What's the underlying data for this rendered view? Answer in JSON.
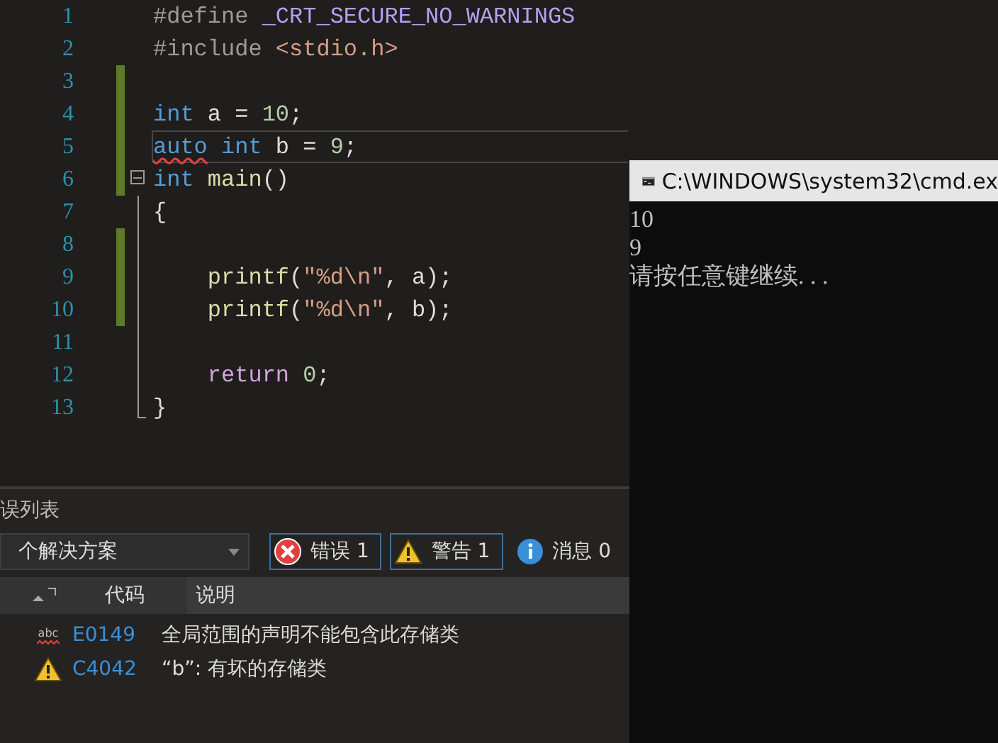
{
  "editor": {
    "lines": [
      {
        "number": "1",
        "changed": false,
        "current": false,
        "tokens": [
          {
            "t": "#define",
            "kind": "pre"
          },
          {
            "t": " _CRT_SECURE_NO_WARNINGS",
            "kind": "macro"
          }
        ]
      },
      {
        "number": "2",
        "changed": false,
        "current": false,
        "tokens": [
          {
            "t": "#include",
            "kind": "pre"
          },
          {
            "t": " <stdio.h>",
            "kind": "str"
          }
        ]
      },
      {
        "number": "3",
        "changed": true,
        "current": false
      },
      {
        "number": "4",
        "changed": true,
        "current": false,
        "tokens": [
          {
            "t": "int",
            "kind": "kw"
          },
          {
            "t": " a =",
            "kind": "id"
          },
          {
            "t": " 10",
            "kind": "num"
          },
          {
            "t": ";",
            "kind": "id"
          }
        ]
      },
      {
        "number": "5",
        "changed": true,
        "current": true,
        "tokens": [
          {
            "t": "auto",
            "kind": "kw",
            "error": true
          },
          {
            "t": " int",
            "kind": "kw"
          },
          {
            "t": " b =",
            "kind": "id"
          },
          {
            "t": " 9",
            "kind": "num"
          },
          {
            "t": ";",
            "kind": "id"
          }
        ]
      },
      {
        "number": "6",
        "changed": true,
        "current": false,
        "collapsible": true,
        "tokens": [
          {
            "t": "int",
            "kind": "kw"
          },
          {
            "t": " main",
            "kind": "fn"
          },
          {
            "t": "()",
            "kind": "id"
          }
        ]
      },
      {
        "number": "7",
        "changed": false,
        "current": false,
        "in_block": true,
        "tokens": [
          {
            "t": "{",
            "kind": "id"
          }
        ]
      },
      {
        "number": "8",
        "changed": true,
        "current": false,
        "in_block": true
      },
      {
        "number": "9",
        "changed": true,
        "current": false,
        "in_block": true,
        "tokens": [
          {
            "t": "    printf",
            "kind": "fn"
          },
          {
            "t": "(",
            "kind": "id"
          },
          {
            "t": "\"%d\\n\"",
            "kind": "str"
          },
          {
            "t": ", a);",
            "kind": "id"
          }
        ]
      },
      {
        "number": "10",
        "changed": true,
        "current": false,
        "in_block": true,
        "tokens": [
          {
            "t": "    printf",
            "kind": "fn"
          },
          {
            "t": "(",
            "kind": "id"
          },
          {
            "t": "\"%d\\n\"",
            "kind": "str"
          },
          {
            "t": ", b);",
            "kind": "id"
          }
        ]
      },
      {
        "number": "11",
        "changed": false,
        "current": false,
        "in_block": true
      },
      {
        "number": "12",
        "changed": false,
        "current": false,
        "in_block": true,
        "tokens": [
          {
            "t": "    return",
            "kind": "ctl"
          },
          {
            "t": " 0",
            "kind": "num"
          },
          {
            "t": ";",
            "kind": "id"
          }
        ]
      },
      {
        "number": "13",
        "changed": false,
        "current": false,
        "in_block": true,
        "block_end": true,
        "tokens": [
          {
            "t": "}",
            "kind": "id"
          }
        ]
      }
    ]
  },
  "error_list": {
    "title": "误列表",
    "scope": "个解决方案",
    "filters": [
      {
        "kind": "error",
        "label": "错误 1",
        "selected": true
      },
      {
        "kind": "warning",
        "label": "警告 1",
        "selected": true
      },
      {
        "kind": "info",
        "label": "消息 0",
        "selected": false
      }
    ],
    "columns": [
      "代码",
      "说明"
    ],
    "rows": [
      {
        "kind": "intellisense",
        "icon_text": "abc",
        "code": "E0149",
        "description": "全局范围的声明不能包含此存储类"
      },
      {
        "kind": "warning",
        "code": "C4042",
        "description": "“b”: 有坏的存储类"
      }
    ]
  },
  "console": {
    "title": "C:\\WINDOWS\\system32\\cmd.ex",
    "output": [
      "10",
      "9",
      "请按任意键继续. . ."
    ]
  }
}
